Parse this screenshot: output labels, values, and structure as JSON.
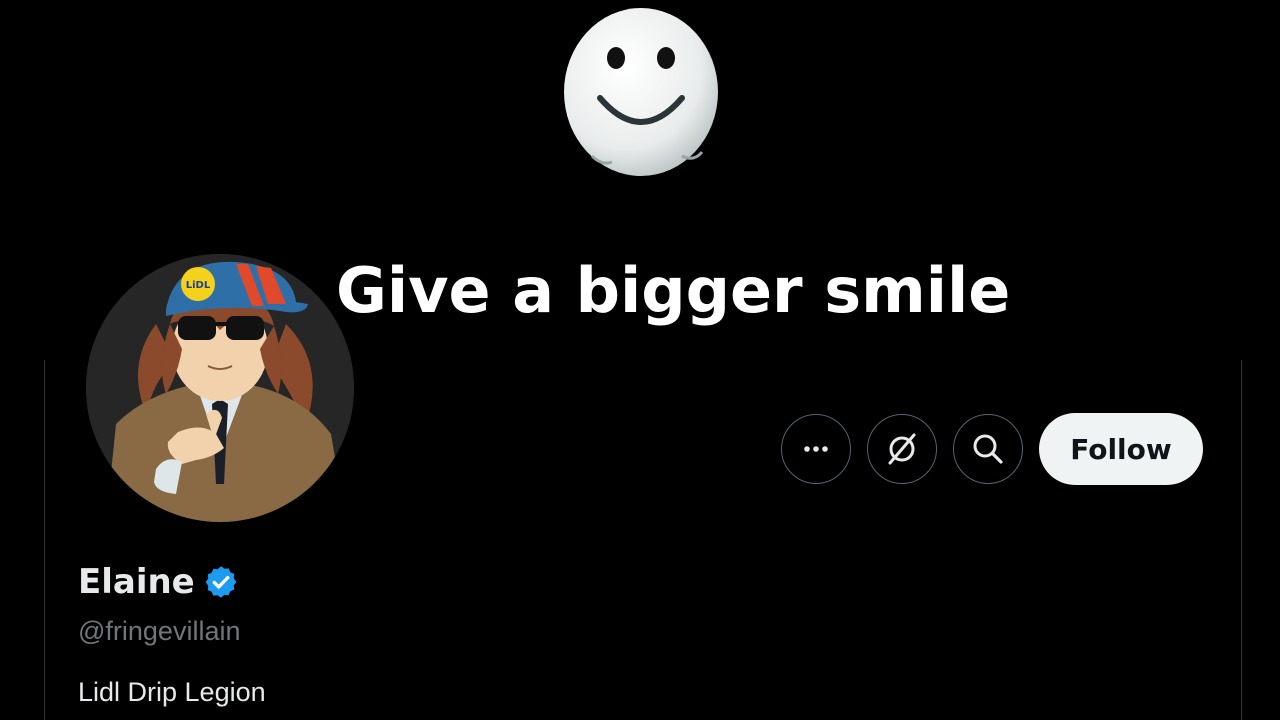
{
  "banner": {
    "caption": "Give a bigger smile",
    "image": "smiley-face-balloon"
  },
  "profile": {
    "avatar": "anime-character-lidl-cap-sunglasses",
    "avatar_cap_text": "LiDL",
    "display_name": "Elaine",
    "verified_badge": "verified-check-icon",
    "handle": "@fringevillain",
    "bio": "Lidl Drip Legion"
  },
  "actions": {
    "more_icon": "more-icon",
    "grok_icon": "grok-icon",
    "search_icon": "search-icon",
    "follow_label": "Follow"
  },
  "colors": {
    "background": "#000000",
    "text_primary": "#e7e9ea",
    "text_secondary": "#71767b",
    "verified_blue": "#1d9bf0",
    "follow_bg": "#eff3f4",
    "border": "#536471"
  }
}
